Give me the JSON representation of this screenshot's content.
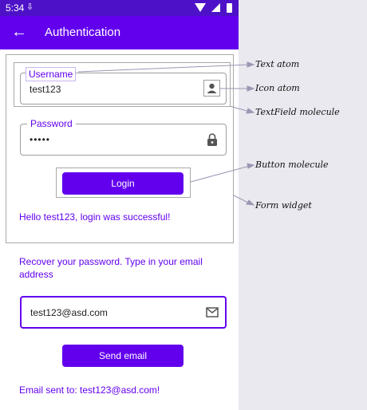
{
  "status_bar": {
    "time": "5:34"
  },
  "app_bar": {
    "title": "Authentication"
  },
  "form": {
    "username_label": "Username",
    "username_value": "test123",
    "password_label": "Password",
    "password_value": "•••••",
    "login_label": "Login",
    "success_message": "Hello test123, login was successful!"
  },
  "recover": {
    "instruction": "Recover your password. Type in your email address",
    "email_value": "test123@asd.com",
    "send_label": "Send email",
    "sent_message": "Email sent to: test123@asd.com!"
  },
  "annotations": {
    "text_atom": "Text atom",
    "icon_atom": "Icon atom",
    "textfield_molecule": "TextField molecule",
    "button_molecule": "Button molecule",
    "form_widget": "Form widget"
  },
  "colors": {
    "primary": "#6200ee",
    "status_bar": "#4d12c7"
  }
}
